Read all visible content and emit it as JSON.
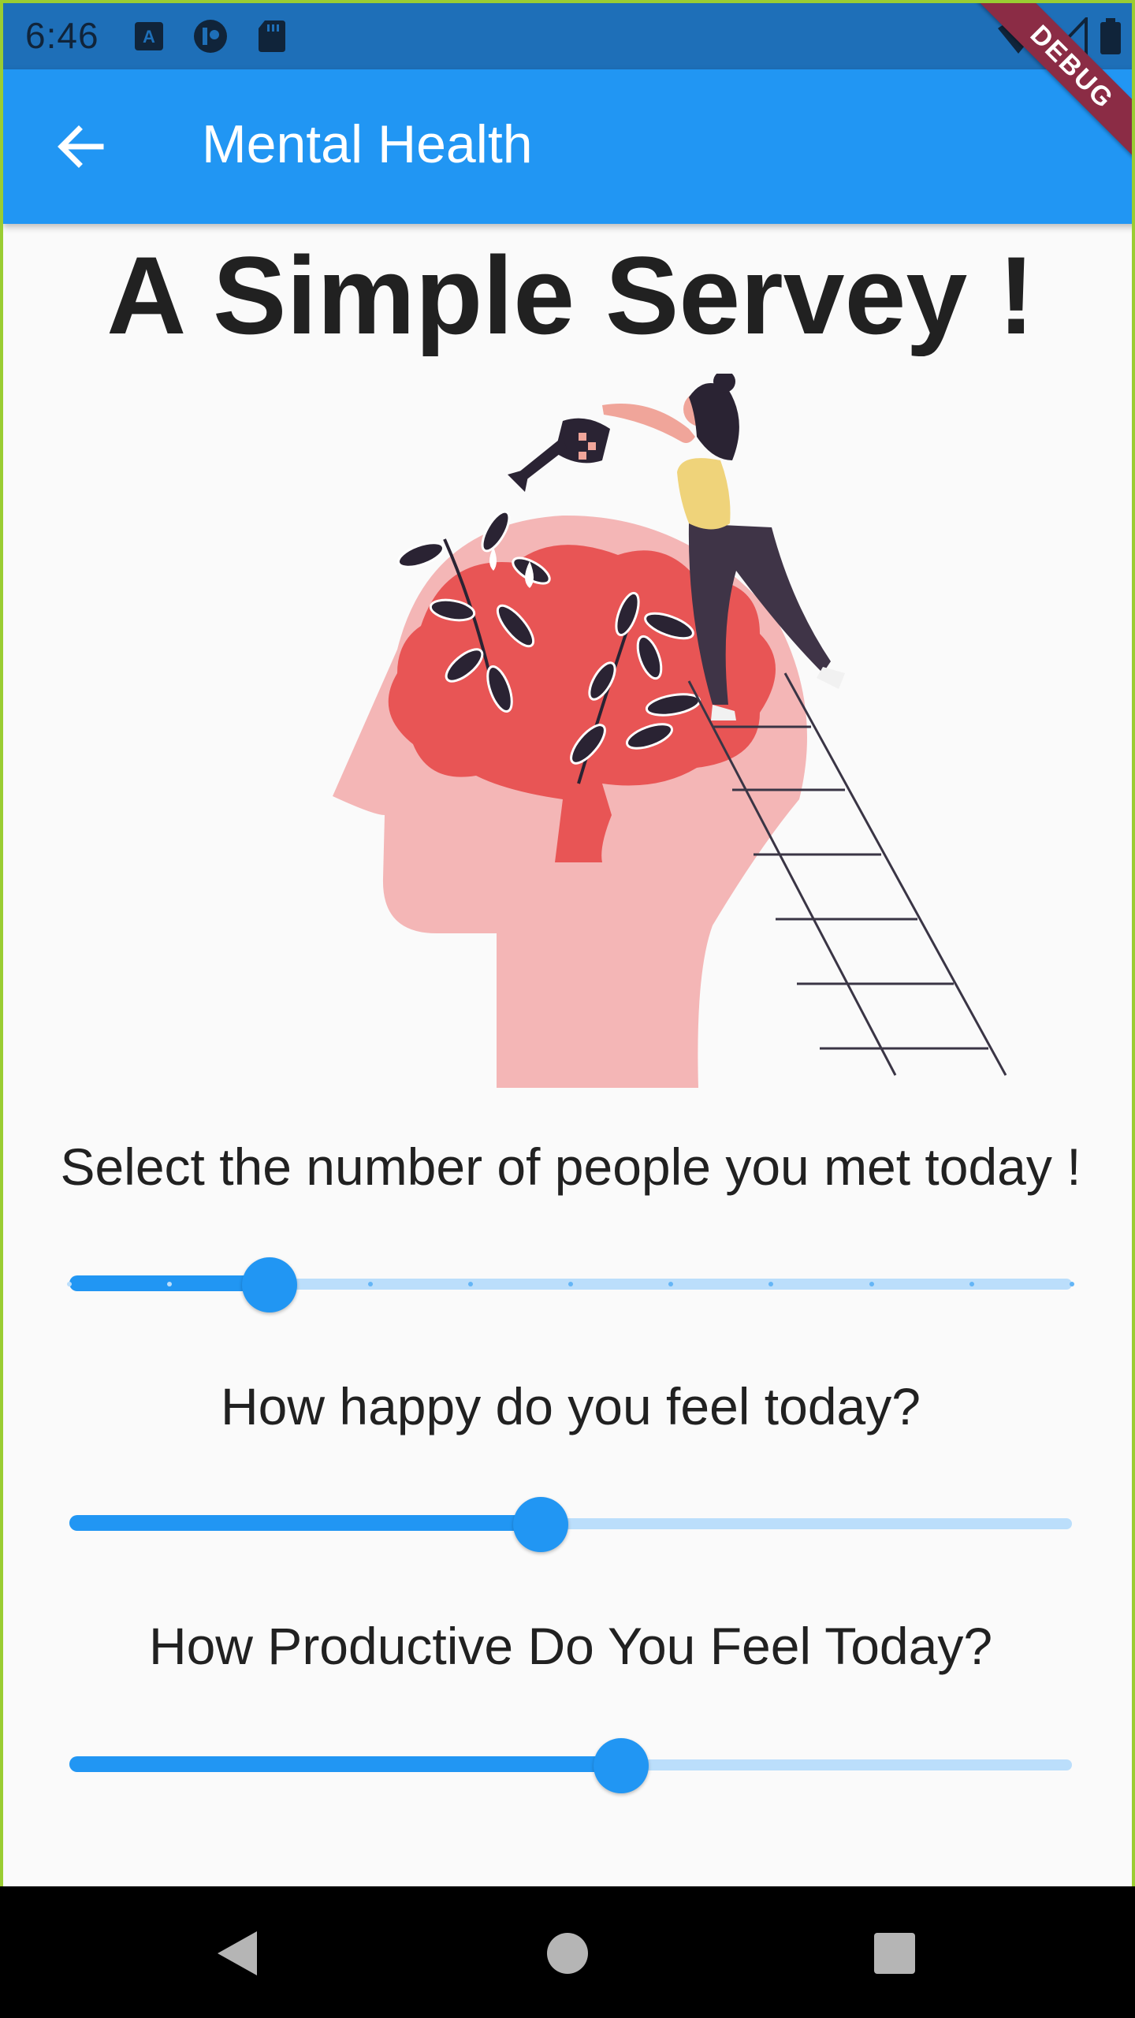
{
  "status_bar": {
    "time": "6:46",
    "left_icons": [
      "a-notification-icon",
      "app-notification-icon",
      "sd-card-icon"
    ],
    "right_icons": [
      "wifi-icon",
      "signal-icon",
      "battery-icon"
    ]
  },
  "app_bar": {
    "title": "Mental Health",
    "back_icon": "arrow-back-icon",
    "debug_banner": "DEBUG"
  },
  "main": {
    "heading": "A Simple Servey !",
    "illustration": "mental-health-plant-illustration",
    "questions": [
      {
        "label": "Select the number of people you met today !",
        "value_fraction": 0.2,
        "divisions": 10
      },
      {
        "label": "How happy do you feel today?",
        "value_fraction": 0.47
      },
      {
        "label": "How Productive Do You Feel Today?",
        "value_fraction": 0.55
      }
    ]
  },
  "colors": {
    "primary": "#2196F3",
    "status_bar": "#1E6FB8",
    "inactive_track": "#BBDEFB",
    "head": "#F4B6B6",
    "brain": "#E85555",
    "debug": "#8B2C45"
  },
  "nav_bar": {
    "icons": [
      "back-triangle-icon",
      "home-circle-icon",
      "recents-square-icon"
    ]
  }
}
